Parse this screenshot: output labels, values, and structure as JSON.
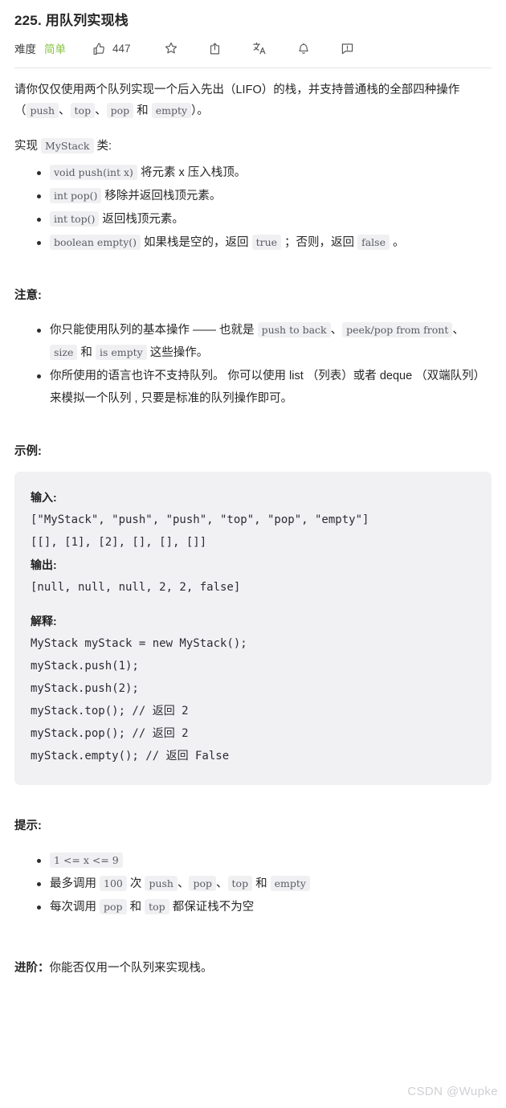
{
  "header": {
    "title": "225. 用队列实现栈",
    "difficulty_label": "难度",
    "difficulty_value": "简单",
    "difficulty_color": "#85c240",
    "like_count": "447",
    "icons": {
      "like": "thumbs-up-icon",
      "star": "star-icon",
      "share": "share-icon",
      "translate": "translate-icon",
      "bell": "bell-icon",
      "feedback": "feedback-icon"
    }
  },
  "description": {
    "p1_a": "请你仅仅使用两个队列实现一个后入先出（LIFO）的栈，并支持普通栈的全部四种操作（",
    "p1_code1": "push",
    "p1_sep1": "、",
    "p1_code2": "top",
    "p1_sep2": "、",
    "p1_code3": "pop",
    "p1_sep3": " 和 ",
    "p1_code4": "empty",
    "p1_end": "）。",
    "p2_a": "实现 ",
    "p2_code": "MyStack",
    "p2_b": " 类:",
    "methods": [
      {
        "code": "void push(int x)",
        "text": " 将元素 x 压入栈顶。"
      },
      {
        "code": "int pop()",
        "text": " 移除并返回栈顶元素。"
      },
      {
        "code": "int top()",
        "text": " 返回栈顶元素。"
      },
      {
        "code": "boolean empty()",
        "text": " 如果栈是空的，返回 ",
        "code2": "true",
        "text2": " ；否则，返回 ",
        "code3": "false",
        "text3": " 。"
      }
    ]
  },
  "notes": {
    "heading": "注意:",
    "items": [
      {
        "t1": "你只能使用队列的基本操作 —— 也就是 ",
        "c1": "push to back",
        "t2": "、",
        "c2": "peek/pop from front",
        "t3": "、",
        "c3": "size",
        "t4": " 和 ",
        "c4": "is empty",
        "t5": " 这些操作。"
      },
      {
        "t1": "你所使用的语言也许不支持队列。 你可以使用 list （列表）或者 deque （双端队列）来模拟一个队列 , 只要是标准的队列操作即可。"
      }
    ]
  },
  "example": {
    "heading": "示例:",
    "input_label": "输入:",
    "input_lines": [
      "[\"MyStack\", \"push\", \"push\", \"top\", \"pop\", \"empty\"]",
      "[[], [1], [2], [], [], []]"
    ],
    "output_label": "输出:",
    "output_lines": [
      "[null, null, null, 2, 2, false]"
    ],
    "explain_label": "解释:",
    "explain_lines": [
      "MyStack myStack = new MyStack();",
      "myStack.push(1);",
      "myStack.push(2);",
      "myStack.top(); // 返回 2",
      "myStack.pop(); // 返回 2",
      "myStack.empty(); // 返回 False"
    ]
  },
  "hints": {
    "heading": "提示:",
    "items": [
      {
        "c1": "1 <= x <= 9"
      },
      {
        "t1": "最多调用 ",
        "c1": "100",
        "t2": " 次 ",
        "c2": "push",
        "t3": "、",
        "c3": "pop",
        "t4": "、",
        "c4": "top",
        "t5": " 和 ",
        "c5": "empty"
      },
      {
        "t1": "每次调用 ",
        "c1": "pop",
        "t2": " 和 ",
        "c2": "top",
        "t3": " 都保证栈不为空"
      }
    ]
  },
  "followup": {
    "label": "进阶：",
    "text": "你能否仅用一个队列来实现栈。"
  },
  "watermark": "CSDN @Wupke"
}
